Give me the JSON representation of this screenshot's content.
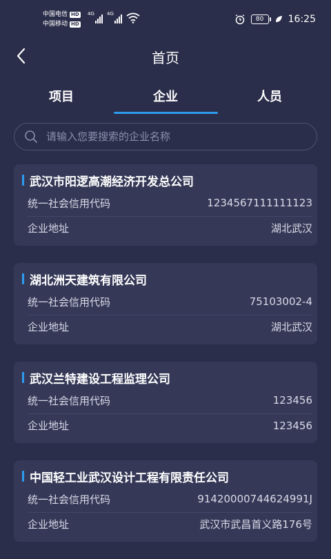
{
  "status_bar": {
    "carrier1": "中国电信",
    "carrier2": "中国移动",
    "hd_label": "HD",
    "network1": "4G",
    "network2": "4G",
    "battery": "80",
    "time": "16:25",
    "icons": [
      "alarm-icon",
      "battery-icon",
      "leaf-icon",
      "wifi-icon",
      "signal-icon"
    ]
  },
  "header": {
    "title": "首页",
    "back_icon": "chevron-left-icon"
  },
  "tabs": [
    {
      "label": "项目",
      "active": false
    },
    {
      "label": "企业",
      "active": true
    },
    {
      "label": "人员",
      "active": false
    }
  ],
  "search": {
    "placeholder": "请输入您要搜索的企业名称",
    "value": ""
  },
  "companies": [
    {
      "name": "武汉市阳逻高潮经济开发总公司",
      "credit_label": "统一社会信用代码",
      "credit_code": "1234567111111123",
      "address_label": "企业地址",
      "address": "湖北武汉"
    },
    {
      "name": "湖北洲天建筑有限公司",
      "credit_label": "统一社会信用代码",
      "credit_code": "75103002-4",
      "address_label": "企业地址",
      "address": "湖北武汉"
    },
    {
      "name": "武汉兰特建设工程监理公司",
      "credit_label": "统一社会信用代码",
      "credit_code": "123456",
      "address_label": "企业地址",
      "address": "123456"
    },
    {
      "name": "中国轻工业武汉设计工程有限责任公司",
      "credit_label": "统一社会信用代码",
      "credit_code": "91420000744624991J",
      "address_label": "企业地址",
      "address": "武汉市武昌首义路176号"
    }
  ],
  "colors": {
    "background": "#2b2e4a",
    "card": "#353957",
    "accent": "#2e9bf0"
  }
}
